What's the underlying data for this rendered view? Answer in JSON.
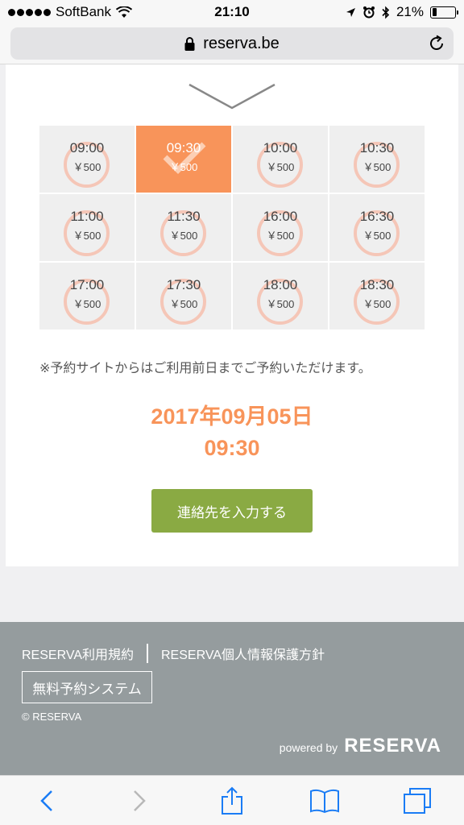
{
  "status_bar": {
    "carrier": "SoftBank",
    "time": "21:10",
    "battery": "21%",
    "battery_level": 0.21,
    "icons": [
      "signal-dots-icon",
      "wifi-icon",
      "location-arrow-icon",
      "alarm-icon",
      "bluetooth-icon",
      "battery-icon"
    ]
  },
  "browser": {
    "url": "reserva.be",
    "icons": [
      "lock-icon",
      "reload-icon"
    ]
  },
  "slots": [
    {
      "time": "09:00",
      "price": "￥500",
      "selected": false
    },
    {
      "time": "09:30",
      "price": "￥500",
      "selected": true
    },
    {
      "time": "10:00",
      "price": "￥500",
      "selected": false
    },
    {
      "time": "10:30",
      "price": "￥500",
      "selected": false
    },
    {
      "time": "11:00",
      "price": "￥500",
      "selected": false
    },
    {
      "time": "11:30",
      "price": "￥500",
      "selected": false
    },
    {
      "time": "16:00",
      "price": "￥500",
      "selected": false
    },
    {
      "time": "16:30",
      "price": "￥500",
      "selected": false
    },
    {
      "time": "17:00",
      "price": "￥500",
      "selected": false
    },
    {
      "time": "17:30",
      "price": "￥500",
      "selected": false
    },
    {
      "time": "18:00",
      "price": "￥500",
      "selected": false
    },
    {
      "time": "18:30",
      "price": "￥500",
      "selected": false
    }
  ],
  "note": "※予約サイトからはご利用前日までご予約いただけます。",
  "selection": {
    "date": "2017年09月05日",
    "time": "09:30"
  },
  "cta_label": "連絡先を入力する",
  "footer": {
    "terms_link": "RESERVA利用規約",
    "privacy_link": "RESERVA個人情報保護方針",
    "badge": "無料予約システム",
    "copyright": "© RESERVA",
    "powered_by": "powered by",
    "brand": "RESERVA"
  },
  "colors": {
    "accent": "#f8945a",
    "ring": "#f5c6b7",
    "cta": "#8aaa43",
    "footer_bg": "#959c9e",
    "ios_blue": "#1a7cf5"
  },
  "toolbar_icons": [
    "back-icon",
    "forward-icon",
    "share-icon",
    "bookmarks-icon",
    "tabs-icon"
  ]
}
